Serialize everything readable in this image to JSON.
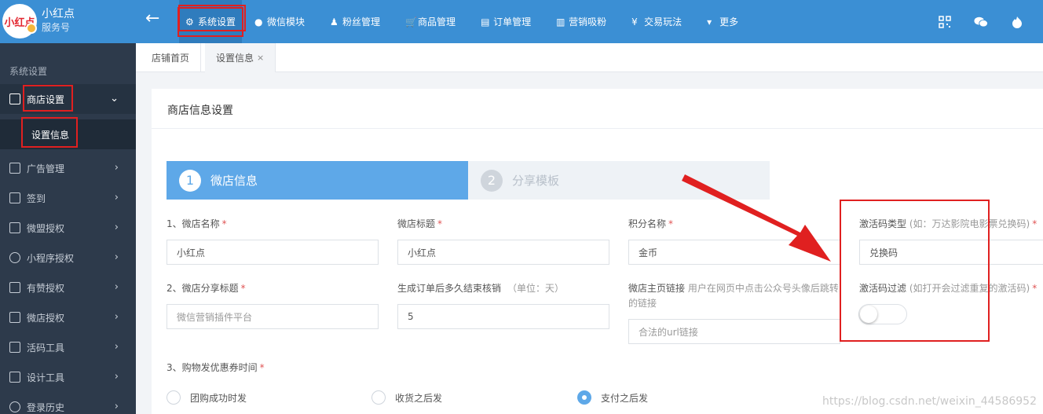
{
  "brand": {
    "logo_text": "小红点",
    "name": "小红点",
    "subtitle": "服务号"
  },
  "nav": {
    "back": "←",
    "items": [
      {
        "label": "系统设置",
        "icon": "⚙"
      },
      {
        "label": "微信模块",
        "icon": "●"
      },
      {
        "label": "粉丝管理",
        "icon": "♟"
      },
      {
        "label": "商品管理",
        "icon": "🛒"
      },
      {
        "label": "订单管理",
        "icon": "▤"
      },
      {
        "label": "营销吸粉",
        "icon": "▥"
      },
      {
        "label": "交易玩法",
        "icon": "¥"
      },
      {
        "label": "更多",
        "icon": "▾"
      }
    ]
  },
  "sidebar": {
    "heading": "系统设置",
    "items": [
      {
        "label": "商店设置"
      },
      {
        "label": "设置信息"
      },
      {
        "label": "广告管理"
      },
      {
        "label": "签到"
      },
      {
        "label": "微盟授权"
      },
      {
        "label": "小程序授权"
      },
      {
        "label": "有赞授权"
      },
      {
        "label": "微店授权"
      },
      {
        "label": "活码工具"
      },
      {
        "label": "设计工具"
      },
      {
        "label": "登录历史"
      }
    ]
  },
  "tabs": [
    {
      "label": "店铺首页"
    },
    {
      "label": "设置信息",
      "close": "×"
    }
  ],
  "panel": {
    "title": "商店信息设置",
    "steps": [
      {
        "num": "1",
        "label": "微店信息"
      },
      {
        "num": "2",
        "label": "分享模板"
      }
    ],
    "fields": {
      "shop_name": {
        "label": "1、微店名称",
        "value": "小红点"
      },
      "shop_title": {
        "label": "微店标题",
        "value": "小红点"
      },
      "points_name": {
        "label": "积分名称",
        "value": "金币"
      },
      "code_type": {
        "label": "激活码类型",
        "hint": " (如：万达影院电影票兑换码)",
        "value": "兑换码"
      },
      "share_title": {
        "label": "2、微店分享标题",
        "placeholder": "微信营销插件平台"
      },
      "order_end": {
        "label": "生成订单后多久结束核销",
        "hint": "（单位：天）",
        "value": "5"
      },
      "home_link": {
        "label": "微店主页链接",
        "hint": " 用户在网页中点击公众号头像后跳转",
        "hint2": "的链接",
        "placeholder": "合法的url链接"
      },
      "code_filter": {
        "label": "激活码过滤",
        "hint": " (如打开会过滤重复的激活码)",
        "enabled": false
      },
      "coupon_time": {
        "label": "3、购物发优惠券时间",
        "options": [
          "团购成功时发",
          "收货之后发",
          "支付之后发"
        ],
        "selected": "支付之后发"
      }
    },
    "required_mark": "*"
  },
  "watermark": "https://blog.csdn.net/weixin_44586952",
  "colors": {
    "topbar": "#3b8fd4",
    "sidebar": "#2d3a4b",
    "accent": "#5ea8e8",
    "highlight": "#e02020"
  }
}
